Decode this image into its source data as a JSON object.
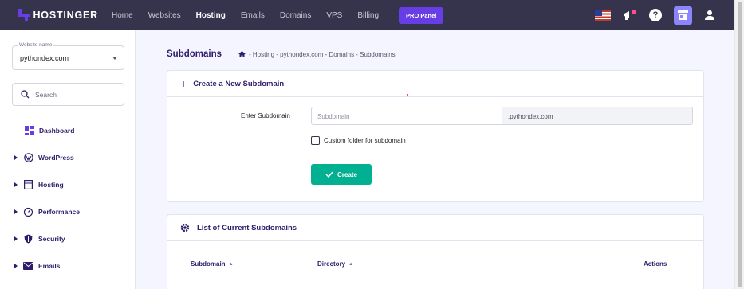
{
  "brand": {
    "name": "HOSTINGER",
    "accent": "#673de6"
  },
  "topnav": {
    "items": [
      "Home",
      "Websites",
      "Hosting",
      "Emails",
      "Domains",
      "VPS",
      "Billing"
    ],
    "active": "Hosting",
    "pro_label": "PRO Panel"
  },
  "topbar_icons": [
    "us-flag-icon",
    "megaphone-icon",
    "help-icon",
    "store-icon",
    "user-icon"
  ],
  "sidebar": {
    "website_legend": "Website name",
    "website_value": "pythondex.com",
    "search_placeholder": "Search",
    "items": [
      {
        "label": "Dashboard",
        "icon": "dashboard-icon"
      },
      {
        "label": "WordPress",
        "icon": "wordpress-icon"
      },
      {
        "label": "Hosting",
        "icon": "hosting-icon"
      },
      {
        "label": "Performance",
        "icon": "performance-icon"
      },
      {
        "label": "Security",
        "icon": "security-icon"
      },
      {
        "label": "Emails",
        "icon": "email-icon"
      }
    ]
  },
  "page": {
    "title": "Subdomains",
    "breadcrumb": "- Hosting - pythondex.com - Domains - Subdomains"
  },
  "create_card": {
    "title": "Create a New Subdomain",
    "field_label": "Enter Subdomain",
    "input_placeholder": "Subdomain",
    "domain_suffix": ".pythondex.com",
    "checkbox_label": "Custom folder for subdomain",
    "button_label": "Create",
    "button_color": "#00b090"
  },
  "list_card": {
    "title": "List of Current Subdomains",
    "columns": [
      "Subdomain",
      "Directory",
      "Actions"
    ]
  }
}
